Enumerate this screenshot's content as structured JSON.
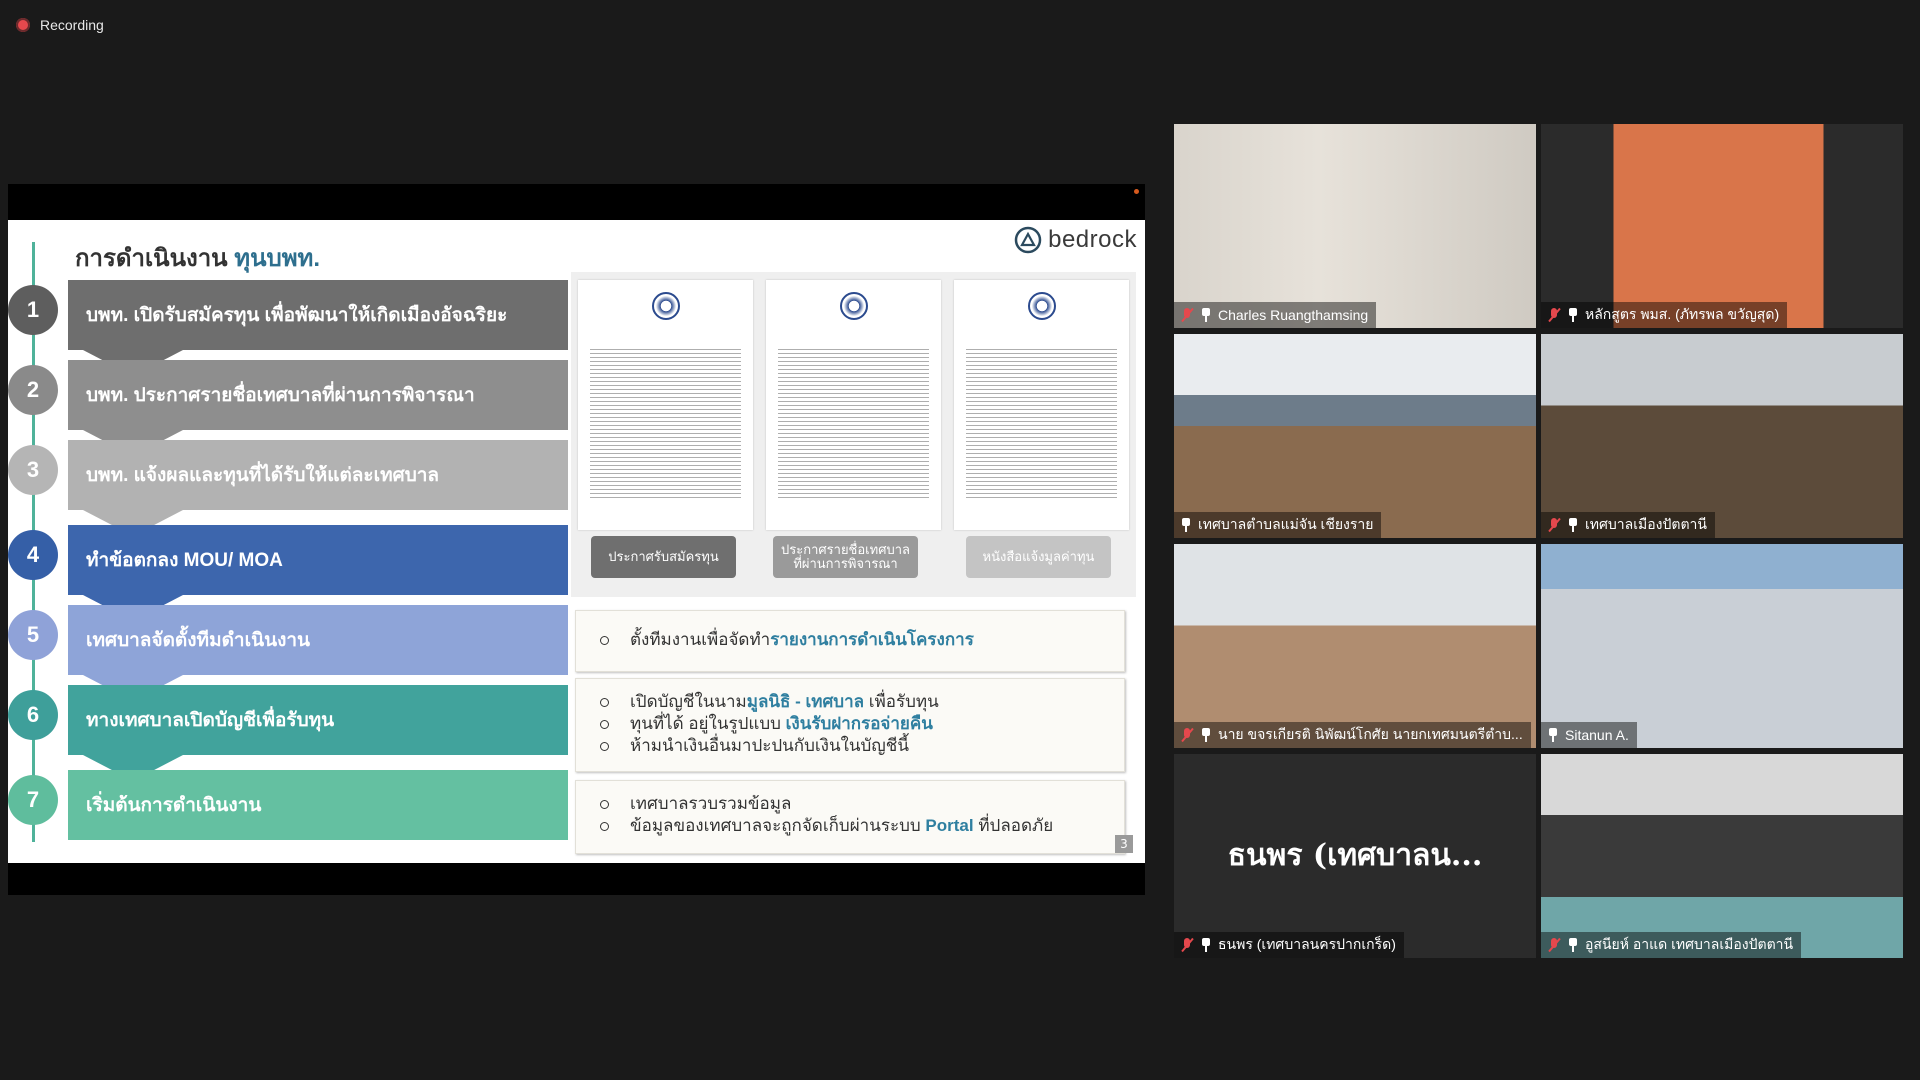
{
  "recording": {
    "label": "Recording",
    "dot_color": "#e5484d"
  },
  "slide": {
    "title_main": "การดำเนินงาน",
    "title_accent": "ทุนบพท.",
    "brand": "bedrock",
    "page_number": "3",
    "steps": [
      {
        "num": "1",
        "text": "บพท. เปิดรับสมัครทุน เพื่อพัฒนาให้เกิดเมืองอัจฉริยะ",
        "color": "#6e6e6e",
        "num_color": "#5e5e5e"
      },
      {
        "num": "2",
        "text": "บพท. ประกาศรายชื่อเทศบาลที่ผ่านการพิจารณา",
        "color": "#8e8e8e",
        "num_color": "#8a8a8a"
      },
      {
        "num": "3",
        "text": "บพท. แจ้งผลและทุนที่ได้รับให้แต่ละเทศบาล",
        "color": "#b2b2b2",
        "num_color": "#b5b5b5"
      },
      {
        "num": "4",
        "text": "ทำข้อตกลง MOU/ MOA",
        "color": "#3d66ad",
        "num_color": "#355fa7"
      },
      {
        "num": "5",
        "text": "เทศบาลจัดตั้งทีมดำเนินงาน",
        "color": "#8ea4d8",
        "num_color": "#8fa2d8"
      },
      {
        "num": "6",
        "text": "ทางเทศบาลเปิดบัญชีเพื่อรับทุน",
        "color": "#41a39c",
        "num_color": "#3e9f9a"
      },
      {
        "num": "7",
        "text": "เริ่มต้นการดำเนินงาน",
        "color": "#64c0a1",
        "num_color": "#5fbd9d"
      }
    ],
    "doc_buttons": [
      "ประกาศรับสมัครทุน",
      "ประกาศรายชื่อเทศบาลที่ผ่านการพิจารณา",
      "หนังสือแจ้งมูลค่าทุน"
    ],
    "info": {
      "box1": {
        "pre": "ตั้งทีมงานเพื่อจัดทำ",
        "hl": "รายงานการดำเนินโครงการ"
      },
      "box2": [
        {
          "pre": "เปิดบัญชีในนาม",
          "hl": "มูลนิธิ - เทศบาล",
          "post": " เพื่อรับทุน"
        },
        {
          "pre": "ทุนที่ได้ อยู่ในรูปแบบ ",
          "hl": "เงินรับฝากรอจ่ายคืน",
          "post": ""
        },
        {
          "pre": "ห้ามนำเงินอื่นมาปะปนกับเงินในบัญชีนี้",
          "hl": "",
          "post": ""
        }
      ],
      "box3": [
        {
          "pre": "เทศบาลรวบรวมข้อมูล",
          "hl": "",
          "post": ""
        },
        {
          "pre": "ข้อมูลของเทศบาลจะถูกจัดเก็บผ่านระบบ ",
          "hl": "Portal",
          "post": " ที่ปลอดภัย"
        }
      ]
    }
  },
  "participants": [
    {
      "name": "Charles Ruangthamsing",
      "muted": true
    },
    {
      "name": "หลักสูตร พมส. (ภัทรพล ขวัญสุด)",
      "muted": true
    },
    {
      "name": "เทศบาลตำบลแม่จัน เชียงราย",
      "muted": false
    },
    {
      "name": "เทศบาลเมืองปัตตานี",
      "muted": true
    },
    {
      "name": "นาย ขจรเกียรติ นิพัฒน์โกศัย นายกเทศมนตรีตำบ...",
      "muted": true
    },
    {
      "name": "Sitanun A.",
      "muted": false,
      "active": true
    },
    {
      "name": "ธนพร (เทศบาลนครปากเกร็ด)",
      "muted": true,
      "video_off_label": "ธนพร (เทศบาลน..."
    },
    {
      "name": "อูสนียห์ อาแด เทศบาลเมืองปัตตานี",
      "muted": true
    }
  ],
  "colors": {
    "active_speaker": "#b9e35a",
    "muted_red": "#e5484d",
    "accent_blue": "#2f7fa0"
  }
}
